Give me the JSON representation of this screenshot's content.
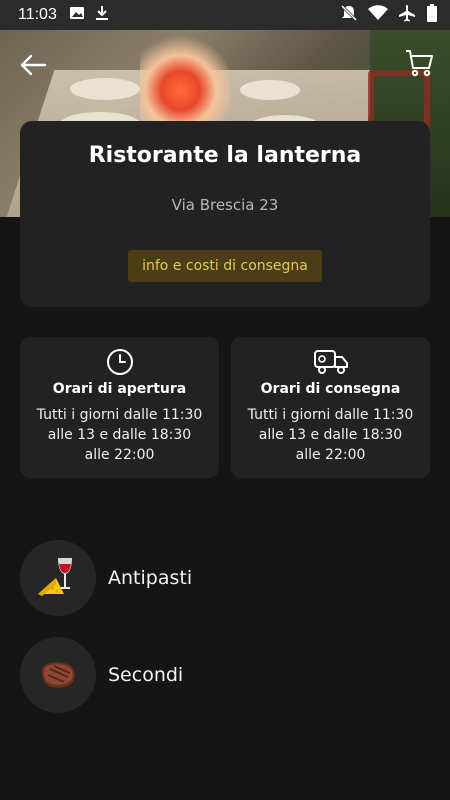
{
  "status_bar": {
    "time": "11:03"
  },
  "restaurant": {
    "name": "Ristorante la lanterna",
    "address": "Via Brescia 23",
    "delivery_info_label": "info e costi di consegna"
  },
  "hours": [
    {
      "title": "Orari di apertura",
      "text": "Tutti i giorni dalle 11:30 alle 13 e dalle 18:30 alle 22:00",
      "icon": "clock-icon"
    },
    {
      "title": "Orari di consegna",
      "text": "Tutti i giorni dalle 11:30 alle 13 e dalle 18:30 alle 22:00",
      "icon": "delivery-truck-icon"
    }
  ],
  "categories": [
    {
      "label": "Antipasti",
      "icon": "wine-cheese-icon"
    },
    {
      "label": "Secondi",
      "icon": "steak-icon"
    }
  ],
  "colors": {
    "background": "#151515",
    "card": "#222222",
    "accent_text": "#e6c75a",
    "accent_bg": "#4b3e17"
  }
}
